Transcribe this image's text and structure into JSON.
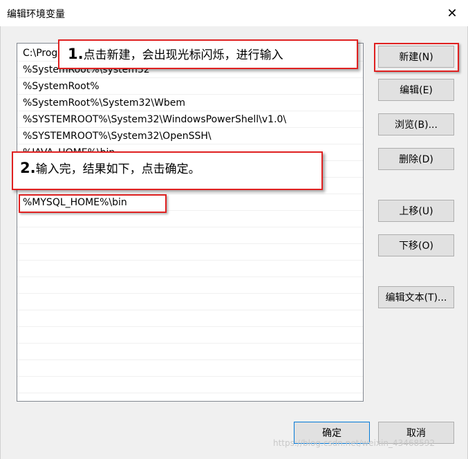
{
  "window": {
    "title": "编辑环境变量",
    "close_glyph": "✕"
  },
  "paths": [
    "C:\\Prog",
    "%SystemRoot%\\system32",
    "%SystemRoot%",
    "%SystemRoot%\\System32\\Wbem",
    "%SYSTEMROOT%\\System32\\WindowsPowerShell\\v1.0\\",
    "%SYSTEMROOT%\\System32\\OpenSSH\\",
    "%JAVA_HOME%\\bin",
    "",
    "",
    "%MYSQL_HOME%\\bin"
  ],
  "buttons": {
    "new": "新建(N)",
    "edit": "编辑(E)",
    "browse": "浏览(B)...",
    "delete": "删除(D)",
    "move_up": "上移(U)",
    "move_down": "下移(O)",
    "edit_text": "编辑文本(T)...",
    "ok": "确定",
    "cancel": "取消"
  },
  "annotations": {
    "step1_num": "1.",
    "step1_text": "点击新建，会出现光标闪烁，进行输入",
    "step2_num": "2.",
    "step2_text": "输入完，结果如下，点击确定。"
  },
  "watermark": "https://blog.csdn.net/weixin_43468592",
  "colors": {
    "annotation_border": "#e02020",
    "default_button_border": "#0078d7"
  }
}
